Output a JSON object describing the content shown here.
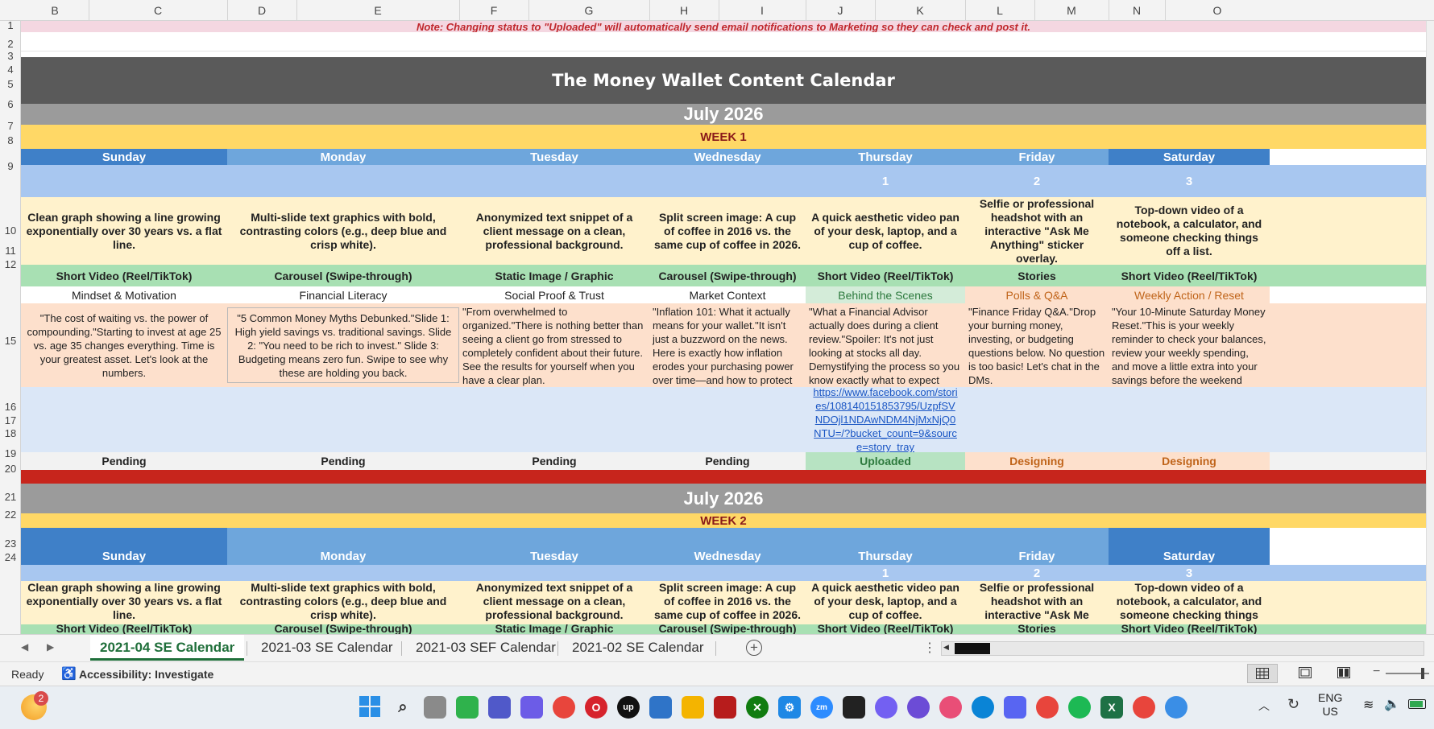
{
  "columns": [
    "B",
    "C",
    "D",
    "E",
    "F",
    "G",
    "H",
    "I",
    "J",
    "K",
    "L",
    "M",
    "N",
    "O"
  ],
  "rows": [
    "1",
    "2",
    "3",
    "4",
    "5",
    "6",
    "7",
    "8",
    "9",
    "10",
    "11",
    "12",
    "15",
    "16",
    "17",
    "18",
    "19",
    "20",
    "21",
    "22",
    "23",
    "24"
  ],
  "note": "Note: Changing status to \"Uploaded\" will automatically send email notifications to Marketing so they can check and post it.",
  "title": "The Money Wallet Content Calendar",
  "week1": {
    "month": "July 2026",
    "week": "WEEK 1",
    "days": [
      "Sunday",
      "Monday",
      "Tuesday",
      "Wednesday",
      "Thursday",
      "Friday",
      "Saturday"
    ],
    "dates": [
      "",
      "",
      "",
      "",
      "1",
      "2",
      "3"
    ],
    "descriptions": [
      "Clean graph showing a line growing exponentially over 30 years vs. a flat line.",
      "Multi-slide text graphics with bold, contrasting colors (e.g., deep blue and crisp white).",
      "Anonymized text snippet of a client message on a clean, professional background.",
      "Split screen image: A cup of coffee in 2016 vs. the same cup of coffee in 2026.",
      "A quick aesthetic video pan of your desk, laptop, and a cup of coffee.",
      "Selfie or professional headshot with an interactive \"Ask Me Anything\" sticker overlay.",
      "Top-down video of a notebook, a calculator, and someone checking things off a list."
    ],
    "formats": [
      "Short Video (Reel/TikTok)",
      "Carousel (Swipe-through)",
      "Static Image / Graphic",
      "Carousel (Swipe-through)",
      "Short Video (Reel/TikTok)",
      "Stories",
      "Short Video (Reel/TikTok)"
    ],
    "topics": [
      "Mindset & Motivation",
      "Financial Literacy",
      "Social Proof & Trust",
      "Market Context",
      "Behind the Scenes",
      "Polls & Q&A",
      "Weekly Action / Reset"
    ],
    "captions": [
      "\"The cost of waiting vs. the power of compounding.\"Starting to invest at age 25 vs. age 35 changes everything. Time is your greatest asset. Let's look at the numbers.",
      "\"5 Common Money Myths Debunked.\"Slide 1: High yield savings vs. traditional savings. Slide 2: \"You need to be rich to invest.\" Slide 3: Budgeting means zero fun. Swipe to see why these are holding you back.",
      "\"From overwhelmed to organized.\"There is nothing better than seeing a client go from stressed to completely confident about their future. See the results for yourself when you have a clear plan.",
      "\"Inflation 101: What it actually means for your wallet.\"It isn't just a buzzword on the news. Here is exactly how inflation erodes your purchasing power over time—and how to protect your money.",
      "\"What a Financial Advisor actually does during a client review.\"Spoiler: It's not just looking at stocks all day. Demystifying the process so you know exactly what to expect when you book a",
      "\"Finance Friday Q&A.\"Drop your burning money, investing, or budgeting questions below. No question is too basic! Let's chat in the DMs.",
      "\"Your 10-Minute Saturday Money Reset.\"This is your weekly reminder to check your balances, review your weekly spending, and move a little extra into your savings before the weekend"
    ],
    "link": "https://www.facebook.com/stories/108140151853795/UzpfSVNDOjl1NDAwNDM4NjMxNjQ0NTU=/?bucket_count=9&source=story_tray",
    "statuses": [
      "Pending",
      "Pending",
      "Pending",
      "Pending",
      "Uploaded",
      "Designing",
      "Designing"
    ]
  },
  "week2": {
    "month": "July 2026",
    "week": "WEEK 2",
    "days": [
      "Sunday",
      "Monday",
      "Tuesday",
      "Wednesday",
      "Thursday",
      "Friday",
      "Saturday"
    ],
    "dates": [
      "",
      "",
      "",
      "",
      "1",
      "2",
      "3"
    ],
    "descriptions": [
      "Clean graph showing a line growing exponentially over 30 years vs. a flat line.",
      "Multi-slide text graphics with bold, contrasting colors (e.g., deep blue and crisp white).",
      "Anonymized text snippet of a client message on a clean, professional background.",
      "Split screen image: A cup of coffee in 2016 vs. the same cup of coffee in 2026.",
      "A quick aesthetic video pan of your desk, laptop, and a cup of coffee.",
      "Selfie or professional headshot with an interactive \"Ask Me Anything\" sticker overlay.",
      "Top-down video of a notebook, a calculator, and someone checking things off a list."
    ],
    "formats": [
      "Short Video (Reel/TikTok)",
      "Carousel (Swipe-through)",
      "Static Image / Graphic",
      "Carousel (Swipe-through)",
      "Short Video (Reel/TikTok)",
      "Stories",
      "Short Video (Reel/TikTok)"
    ]
  },
  "tabs": [
    "2021-04 SE Calendar",
    "2021-03 SE Calendar",
    "2021-03 SEF Calendar",
    "2021-02 SE Calendar"
  ],
  "statusbar": {
    "ready": "Ready",
    "accessibility": "Accessibility: Investigate"
  },
  "taskbar": {
    "lang1": "ENG",
    "lang2": "US",
    "weather_badge": "2"
  },
  "colors": {
    "note_bg": "#f4d7e1",
    "note_text": "#c0282d",
    "title_bg": "#5a5a5a",
    "month_bg": "#9b9b9b",
    "week_bg": "#ffd866",
    "week_text": "#8a1a1a",
    "day_dark": "#3f80c8",
    "day_light": "#6ea6dc",
    "date_bg": "#a8c7f0",
    "desc_bg": "#fff2cc",
    "fmt_bg": "#a8e0b3",
    "cap_bg": "#fde0cc",
    "link_bg": "#dbe7f7",
    "red_band": "#c7251c",
    "uploaded_bg": "#b7e3c2",
    "designing_bg": "#fde0cc"
  }
}
